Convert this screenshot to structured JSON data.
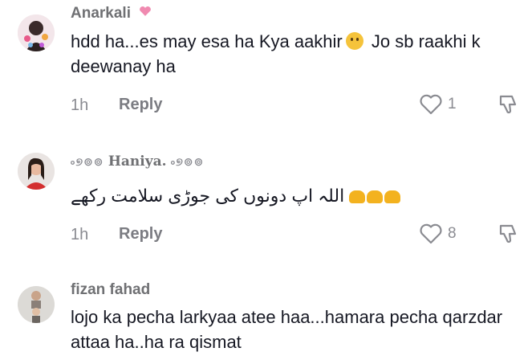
{
  "comments": [
    {
      "username": "Anarkali",
      "text_part1": "hdd ha...es may esa ha Kya aakhir",
      "text_part2": " Jo sb raakhi k deewanay ha",
      "time": "1h",
      "reply_label": "Reply",
      "likes": "1"
    },
    {
      "username_deco_left": "৹୭⊚⊚",
      "username": "Haniya.",
      "username_deco_right": "৹୭⊚⊚",
      "text": "اللہ اپ دونوں کی جوڑی سلامت رکھے",
      "time": "1h",
      "reply_label": "Reply",
      "likes": "8"
    },
    {
      "username": "fizan fahad",
      "text": "lojo ka pecha larkyaa atee haa...hamara pecha qarzdar attaa ha..ha ra qismat"
    }
  ],
  "colors": {
    "text": "#161823",
    "muted": "#8a8b91",
    "pink_heart": "#f08ab0",
    "emoji_yellow": "#f3b21f"
  },
  "icons": [
    "thinking-face-emoji",
    "pink-hearts-emoji",
    "heart-outline-icon",
    "thumbs-down-outline-icon",
    "folded-hands-emoji"
  ]
}
